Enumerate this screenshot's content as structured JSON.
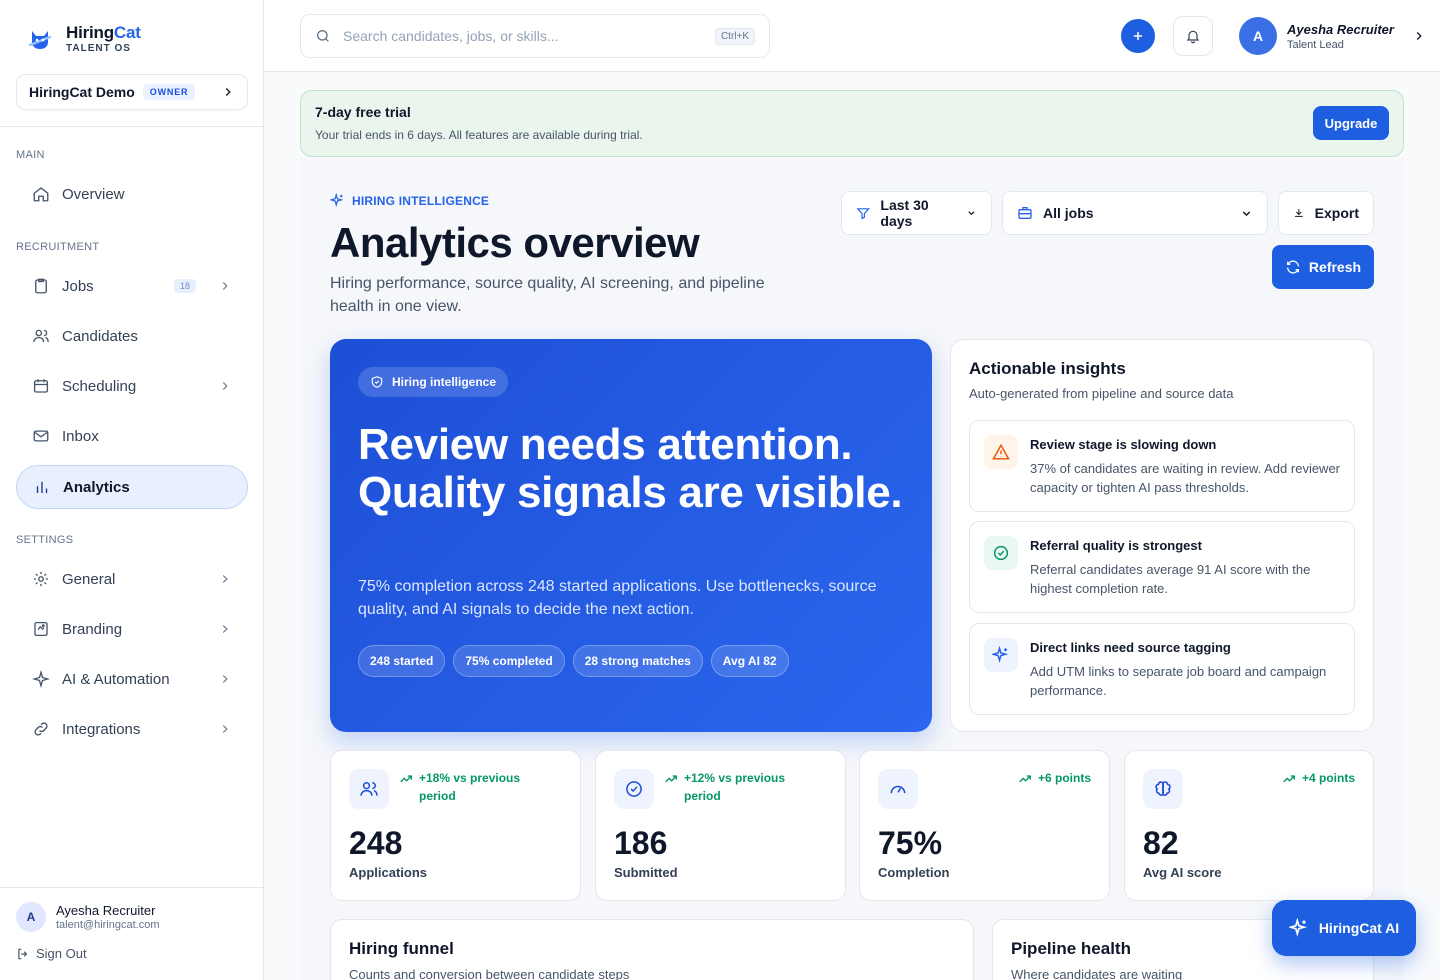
{
  "brand": {
    "name_main": "Hiring",
    "name_accent": "Cat",
    "tagline": "TALENT OS"
  },
  "workspace": {
    "name": "HiringCat Demo",
    "role": "OWNER"
  },
  "sidebar": {
    "sections": {
      "main": "MAIN",
      "recruitment": "RECRUITMENT",
      "settings": "SETTINGS"
    },
    "items": [
      {
        "label": "Overview",
        "icon": "home-icon"
      },
      {
        "label": "Jobs",
        "icon": "clipboard-icon",
        "badge": "18"
      },
      {
        "label": "Candidates",
        "icon": "users-icon"
      },
      {
        "label": "Scheduling",
        "icon": "calendar-icon"
      },
      {
        "label": "Inbox",
        "icon": "mail-icon"
      },
      {
        "label": "Analytics",
        "icon": "bar-chart-icon",
        "active": true
      },
      {
        "label": "General",
        "icon": "gear-icon"
      },
      {
        "label": "Branding",
        "icon": "palette-icon"
      },
      {
        "label": "AI & Automation",
        "icon": "sparkle-icon"
      },
      {
        "label": "Integrations",
        "icon": "link-icon"
      }
    ],
    "user": {
      "initial": "A",
      "name": "Ayesha Recruiter",
      "email": "talent@hiringcat.com"
    },
    "signout": "Sign Out"
  },
  "topbar": {
    "search_placeholder": "Search candidates, jobs, or skills...",
    "shortcut": "Ctrl+K",
    "profile": {
      "initial": "A",
      "name": "Ayesha Recruiter",
      "role": "Talent Lead"
    }
  },
  "trial": {
    "title": "7-day free trial",
    "text": "Your trial ends in 6 days. All features are available during trial.",
    "button": "Upgrade"
  },
  "page": {
    "eyebrow": "HIRING INTELLIGENCE",
    "title": "Analytics overview",
    "description": "Hiring performance, source quality, AI screening, and pipeline health in one view."
  },
  "filters": {
    "period": "Last 30 days",
    "jobs": "All jobs",
    "export": "Export",
    "refresh": "Refresh"
  },
  "hero": {
    "chip": "Hiring intelligence",
    "title": "Review needs attention. Quality signals are visible.",
    "description": "75% completion across 248 started applications. Use bottlenecks, source quality, and AI signals to decide the next action.",
    "pills": [
      "248 started",
      "75% completed",
      "28 strong matches",
      "Avg AI 82"
    ]
  },
  "insights": {
    "title": "Actionable insights",
    "subtitle": "Auto-generated from pipeline and source data",
    "items": [
      {
        "title": "Review stage is slowing down",
        "text": "37% of candidates are waiting in review. Add reviewer capacity or tighten AI pass thresholds.",
        "icon": "warning-icon",
        "color": "#ea580c"
      },
      {
        "title": "Referral quality is strongest",
        "text": "Referral candidates average 91 AI score with the highest completion rate.",
        "icon": "check-circle-icon",
        "color": "#059669"
      },
      {
        "title": "Direct links need source tagging",
        "text": "Add UTM links to separate job board and campaign performance.",
        "icon": "sparkle-icon",
        "color": "#2563eb"
      }
    ]
  },
  "stats": [
    {
      "value": "248",
      "label": "Applications",
      "trend": "+18% vs previous period",
      "icon": "users-icon"
    },
    {
      "value": "186",
      "label": "Submitted",
      "trend": "+12% vs previous period",
      "icon": "check-circle-icon"
    },
    {
      "value": "75%",
      "label": "Completion",
      "trend": "+6 points",
      "icon": "gauge-icon"
    },
    {
      "value": "82",
      "label": "Avg AI score",
      "trend": "+4 points",
      "icon": "brain-icon"
    }
  ],
  "funnel": {
    "title": "Hiring funnel",
    "subtitle": "Counts and conversion between candidate steps"
  },
  "pipeline": {
    "title": "Pipeline health",
    "subtitle": "Where candidates are waiting"
  },
  "ai_button": "HiringCat AI",
  "colors": {
    "primary": "#1d5fe0",
    "success": "#059669",
    "warning": "#ea580c",
    "trial_bg": "#eaf5ee"
  }
}
